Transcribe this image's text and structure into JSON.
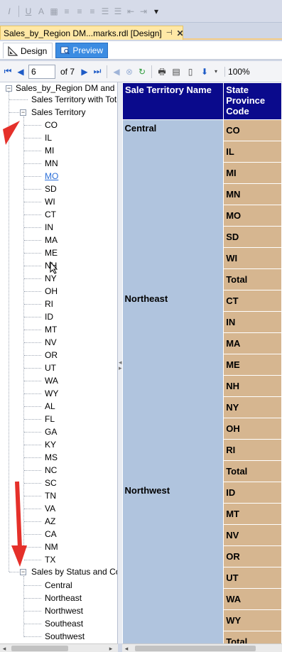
{
  "document_tab": {
    "title": "Sales_by_Region DM...marks.rdl [Design]",
    "pin": "⊣",
    "close": "✕"
  },
  "mode_tabs": {
    "design": "Design",
    "preview": "Preview"
  },
  "report_toolbar": {
    "page_value": "6",
    "page_of": "of 7",
    "zoom": "100%"
  },
  "doc_map": {
    "root": "Sales_by_Region DM and B",
    "node_totals": "Sales Territory with Tot",
    "node_territory": "Sales Territory",
    "states": [
      "CO",
      "IL",
      "MI",
      "MN",
      "MO",
      "SD",
      "WI",
      "CT",
      "IN",
      "MA",
      "ME",
      "NH",
      "NY",
      "OH",
      "RI",
      "ID",
      "MT",
      "NV",
      "OR",
      "UT",
      "WA",
      "WY",
      "AL",
      "FL",
      "GA",
      "KY",
      "MS",
      "NC",
      "SC",
      "TN",
      "VA",
      "AZ",
      "CA",
      "NM",
      "TX"
    ],
    "hovered_state": "MO",
    "node_status": "Sales by Status and Cou",
    "status_items": [
      "Central",
      "Northeast",
      "Northwest",
      "Southeast",
      "Southwest"
    ]
  },
  "report": {
    "col_territory": "Sale Territory Name",
    "col_state": "State Province Code",
    "groups": [
      {
        "name": "Central",
        "states": [
          "CO",
          "IL",
          "MI",
          "MN",
          "MO",
          "SD",
          "WI",
          "Total"
        ]
      },
      {
        "name": "Northeast",
        "states": [
          "CT",
          "IN",
          "MA",
          "ME",
          "NH",
          "NY",
          "OH",
          "RI",
          "Total"
        ]
      },
      {
        "name": "Northwest",
        "states": [
          "ID",
          "MT",
          "NV",
          "OR",
          "UT",
          "WA",
          "WY",
          "Total"
        ]
      }
    ]
  },
  "colors": {
    "header_bg": "#0a0a8c",
    "territory_bg": "#b0c4de",
    "state_bg": "#d6b690",
    "arrow": "#e5302a"
  }
}
